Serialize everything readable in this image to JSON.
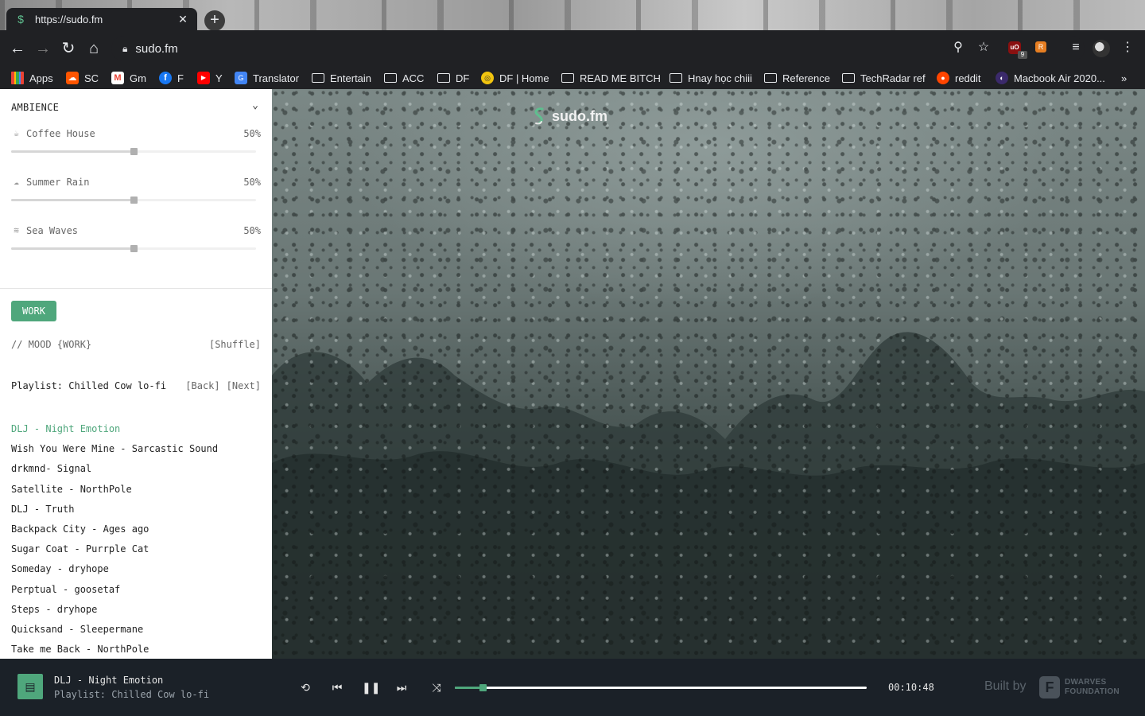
{
  "browser": {
    "tab_title": "https://sudo.fm",
    "tab_close": "✕",
    "new_tab": "+",
    "url": "sudo.fm",
    "extension_badge": "9"
  },
  "bookmarks": [
    {
      "label": "Apps",
      "icon": "apps-grid-icon"
    },
    {
      "label": "SC",
      "icon": "soundcloud-icon"
    },
    {
      "label": "Gm",
      "icon": "gmail-icon"
    },
    {
      "label": "F",
      "icon": "facebook-icon"
    },
    {
      "label": "Y",
      "icon": "youtube-icon"
    },
    {
      "label": "Translator",
      "icon": "google-translate-icon"
    },
    {
      "label": "Entertain",
      "icon": "folder-icon"
    },
    {
      "label": "ACC",
      "icon": "folder-icon"
    },
    {
      "label": "DF",
      "icon": "folder-icon"
    },
    {
      "label": "DF | Home",
      "icon": "df-site-icon"
    },
    {
      "label": "READ ME BITCH",
      "icon": "folder-icon"
    },
    {
      "label": "Hnay học chiii",
      "icon": "folder-icon"
    },
    {
      "label": "Reference",
      "icon": "folder-icon"
    },
    {
      "label": "TechRadar ref",
      "icon": "folder-icon"
    },
    {
      "label": "reddit",
      "icon": "reddit-icon"
    },
    {
      "label": "Macbook Air 2020...",
      "icon": "site-icon"
    }
  ],
  "bookmarks_overflow": "»",
  "sidebar": {
    "ambience_title": "AMBIENCE",
    "ambience": [
      {
        "name": "Coffee House",
        "percent_label": "50%",
        "level": 0.5,
        "icon": "coffee-cup-icon"
      },
      {
        "name": "Summer Rain",
        "percent_label": "50%",
        "level": 0.5,
        "icon": "rain-cloud-icon"
      },
      {
        "name": "Sea Waves",
        "percent_label": "50%",
        "level": 0.5,
        "icon": "waves-icon"
      }
    ],
    "mood_button": "WORK",
    "mood_line": "// MOOD {WORK}",
    "shuffle": "[Shuffle]",
    "playlist_title": "Playlist: Chilled Cow lo-fi",
    "back": "[Back]",
    "next": "[Next]",
    "tracks": [
      "DLJ - Night Emotion",
      "Wish You Were Mine - Sarcastic Sound",
      "drkmnd- Signal",
      "Satellite - NorthPole",
      "DLJ - Truth",
      "Backpack City - Ages ago",
      "Sugar Coat - Purrple Cat",
      "Someday - dryhope",
      "Perptual - goosetaf",
      "Steps - dryhope",
      "Quicksand - Sleepermane",
      "Take me Back - NorthPole"
    ],
    "active_track_index": 0
  },
  "hero": {
    "brand": "sudo.fm"
  },
  "player": {
    "title": "DLJ - Night Emotion",
    "subtitle": "Playlist: Chilled Cow lo-fi",
    "time": "00:10:48",
    "progress": 0.067,
    "built_by": "Built by",
    "org_line1": "DWARVES",
    "org_line2": "FOUNDATION"
  },
  "colors": {
    "accent": "#4fa77c",
    "player_bg": "#1b2128",
    "chrome_bg": "#202124"
  }
}
